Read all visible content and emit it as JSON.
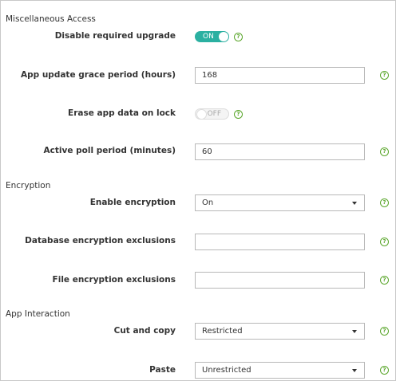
{
  "sections": {
    "misc": "Miscellaneous Access",
    "encryption": "Encryption",
    "app_interaction": "App Interaction"
  },
  "help_glyph": "?",
  "fields": {
    "disable_upgrade": {
      "label": "Disable required upgrade",
      "state": "ON"
    },
    "grace_period": {
      "label": "App update grace period (hours)",
      "value": "168"
    },
    "erase_on_lock": {
      "label": "Erase app data on lock",
      "state": "OFF"
    },
    "poll_period": {
      "label": "Active poll period (minutes)",
      "value": "60"
    },
    "enable_encryption": {
      "label": "Enable encryption",
      "value": "On"
    },
    "db_exclusions": {
      "label": "Database encryption exclusions",
      "value": ""
    },
    "file_exclusions": {
      "label": "File encryption exclusions",
      "value": ""
    },
    "cut_copy": {
      "label": "Cut and copy",
      "value": "Restricted"
    },
    "paste": {
      "label": "Paste",
      "value": "Unrestricted"
    }
  },
  "colors": {
    "toggle_on": "#2bb0a1",
    "help_icon": "#5aa62b"
  }
}
